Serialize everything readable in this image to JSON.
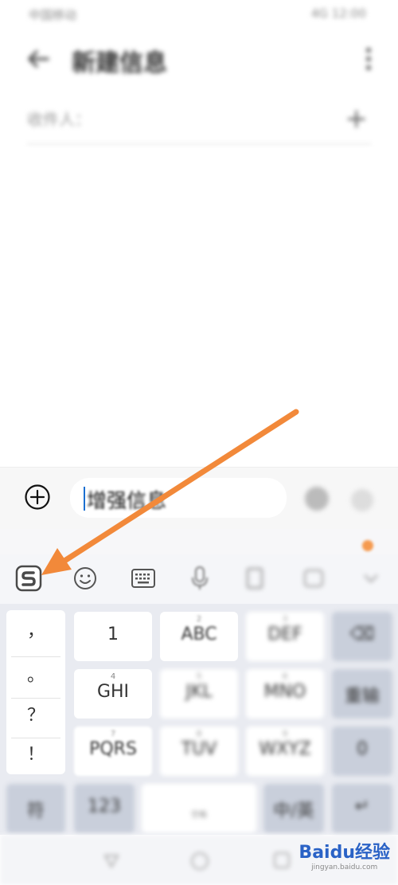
{
  "status": {
    "left_text": "中国移动",
    "right_text": "4G 12:00"
  },
  "header": {
    "title": "新建信息"
  },
  "recipient": {
    "placeholder": "收件人："
  },
  "compose": {
    "text": "增强信息"
  },
  "keyboard": {
    "punctuation": [
      "，",
      "。",
      "？",
      "！"
    ],
    "keys": [
      {
        "sup": "",
        "label": "1"
      },
      {
        "sup": "2",
        "label": "ABC"
      },
      {
        "sup": "3",
        "label": "DEF"
      },
      {
        "sup": "",
        "label": "⌫"
      },
      {
        "sup": "4",
        "label": "GHI"
      },
      {
        "sup": "5",
        "label": "JKL"
      },
      {
        "sup": "6",
        "label": "MNO"
      },
      {
        "sup": "",
        "label": "重输"
      },
      {
        "sup": "7",
        "label": "PQRS"
      },
      {
        "sup": "8",
        "label": "TUV"
      },
      {
        "sup": "9",
        "label": "WXYZ"
      },
      {
        "sup": "",
        "label": "0"
      }
    ],
    "bottom": [
      "符",
      "123",
      "空格",
      "中/英",
      "↵"
    ]
  },
  "watermark": {
    "brand": "Baidu经验",
    "sub": "jingyan.baidu.com"
  },
  "colors": {
    "accent_cursor": "#1a6fd1",
    "arrow": "#f2893a",
    "keyboard_bg": "#e9ebf1"
  }
}
